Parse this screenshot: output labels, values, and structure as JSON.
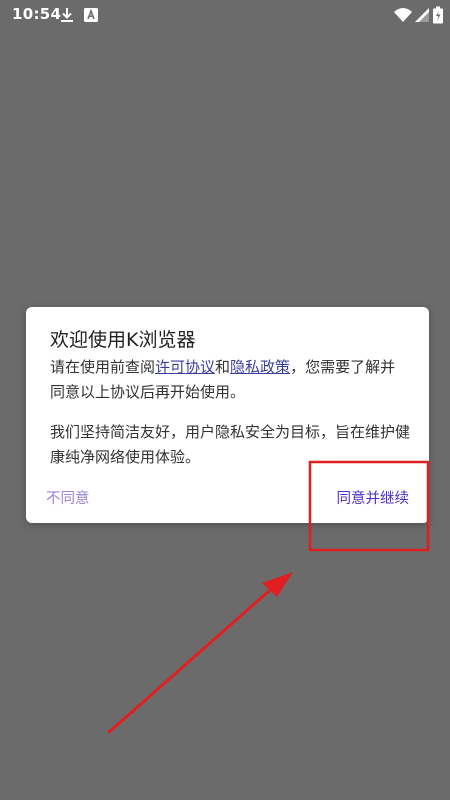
{
  "status_bar": {
    "time": "10:54",
    "icons_left": [
      "download-icon",
      "translate-icon"
    ],
    "icons_right": [
      "wifi-icon",
      "signal-icon",
      "battery-icon"
    ]
  },
  "dialog": {
    "title": "欢迎使用K浏览器",
    "para1_before": "请在使用前查阅",
    "link_license": "许可协议",
    "para1_and": "和",
    "link_privacy": "隐私政策",
    "para1_after": "，您需要了解并同意以上协议后再开始使用。",
    "para2": "我们坚持简洁友好，用户隐私安全为目标，旨在维护健康纯净网络使用体验。",
    "btn_disagree": "不同意",
    "btn_agree": "同意并继续"
  },
  "colors": {
    "background": "#6b6b6b",
    "link": "#3b3f9c",
    "button_agree": "#4e2fc7",
    "button_disagree": "#9b84d6",
    "annotation": "#e02020"
  }
}
